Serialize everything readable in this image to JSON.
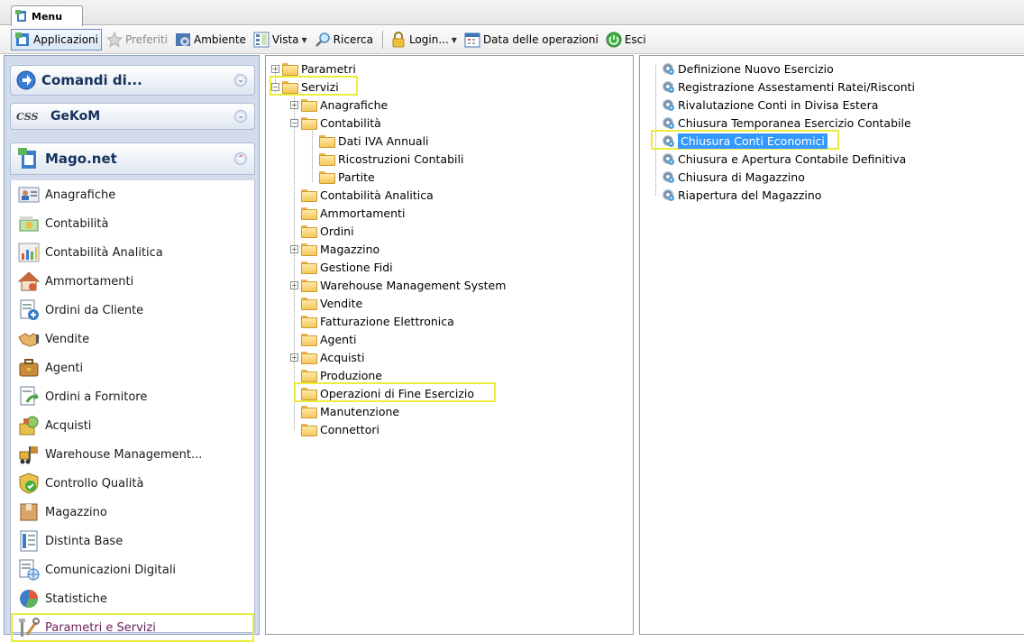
{
  "tab": {
    "label": "Menu"
  },
  "toolbar": {
    "applicazioni": "Applicazioni",
    "preferiti": "Preferiti",
    "ambiente": "Ambiente",
    "vista": "Vista",
    "ricerca": "Ricerca",
    "login": "Login...",
    "data_operazioni": "Data delle operazioni",
    "esci": "Esci"
  },
  "sidebar": {
    "comandi_title": "Comandi di...",
    "gekom_title": "GeKoM",
    "mago_title": "Mago.net",
    "items": [
      {
        "label": "Anagrafiche",
        "icon": "people-card-icon"
      },
      {
        "label": "Contabilità",
        "icon": "money-icon"
      },
      {
        "label": "Contabilità Analitica",
        "icon": "bar-chart-icon"
      },
      {
        "label": "Ammortamenti",
        "icon": "house-icon"
      },
      {
        "label": "Ordini da Cliente",
        "icon": "order-icon"
      },
      {
        "label": "Vendite",
        "icon": "handshake-icon"
      },
      {
        "label": "Agenti",
        "icon": "briefcase-icon"
      },
      {
        "label": "Ordini a Fornitore",
        "icon": "supplier-order-icon"
      },
      {
        "label": "Acquisti",
        "icon": "purchase-icon"
      },
      {
        "label": "Warehouse Management...",
        "icon": "forklift-icon"
      },
      {
        "label": "Controllo Qualità",
        "icon": "quality-shield-icon"
      },
      {
        "label": "Magazzino",
        "icon": "box-icon"
      },
      {
        "label": "Distinta Base",
        "icon": "bom-list-icon"
      },
      {
        "label": "Comunicazioni Digitali",
        "icon": "digital-doc-icon"
      },
      {
        "label": "Statistiche",
        "icon": "pie-chart-icon"
      },
      {
        "label": "Parametri e Servizi",
        "icon": "tools-icon"
      }
    ]
  },
  "tree": {
    "parametri": "Parametri",
    "servizi": "Servizi",
    "anagrafiche": "Anagrafiche",
    "contabilita": "Contabilità",
    "dati_iva": "Dati IVA Annuali",
    "ricostruzioni": "Ricostruzioni Contabili",
    "partite": "Partite",
    "contabilita_analitica": "Contabilità Analitica",
    "ammortamenti": "Ammortamenti",
    "ordini": "Ordini",
    "magazzino": "Magazzino",
    "gestione_fidi": "Gestione Fidi",
    "wms": "Warehouse Management System",
    "vendite": "Vendite",
    "fatturazione": "Fatturazione Elettronica",
    "agenti": "Agenti",
    "acquisti": "Acquisti",
    "produzione": "Produzione",
    "operazioni_fine": "Operazioni di Fine Esercizio",
    "manutenzione": "Manutenzione",
    "connettori": "Connettori"
  },
  "operations": [
    "Definizione Nuovo Esercizio",
    "Registrazione Assestamenti Ratei/Risconti",
    "Rivalutazione Conti in Divisa Estera",
    "Chiusura Temporanea Esercizio Contabile",
    "Chiusura Conti Economici",
    "Chiusura e Apertura Contabile Definitiva",
    "Chiusura di Magazzino",
    "Riapertura del Magazzino"
  ],
  "colors": {
    "highlight": "#ecec3c",
    "selection": "#3399ff",
    "sidebar_bg": "#d3dced"
  }
}
